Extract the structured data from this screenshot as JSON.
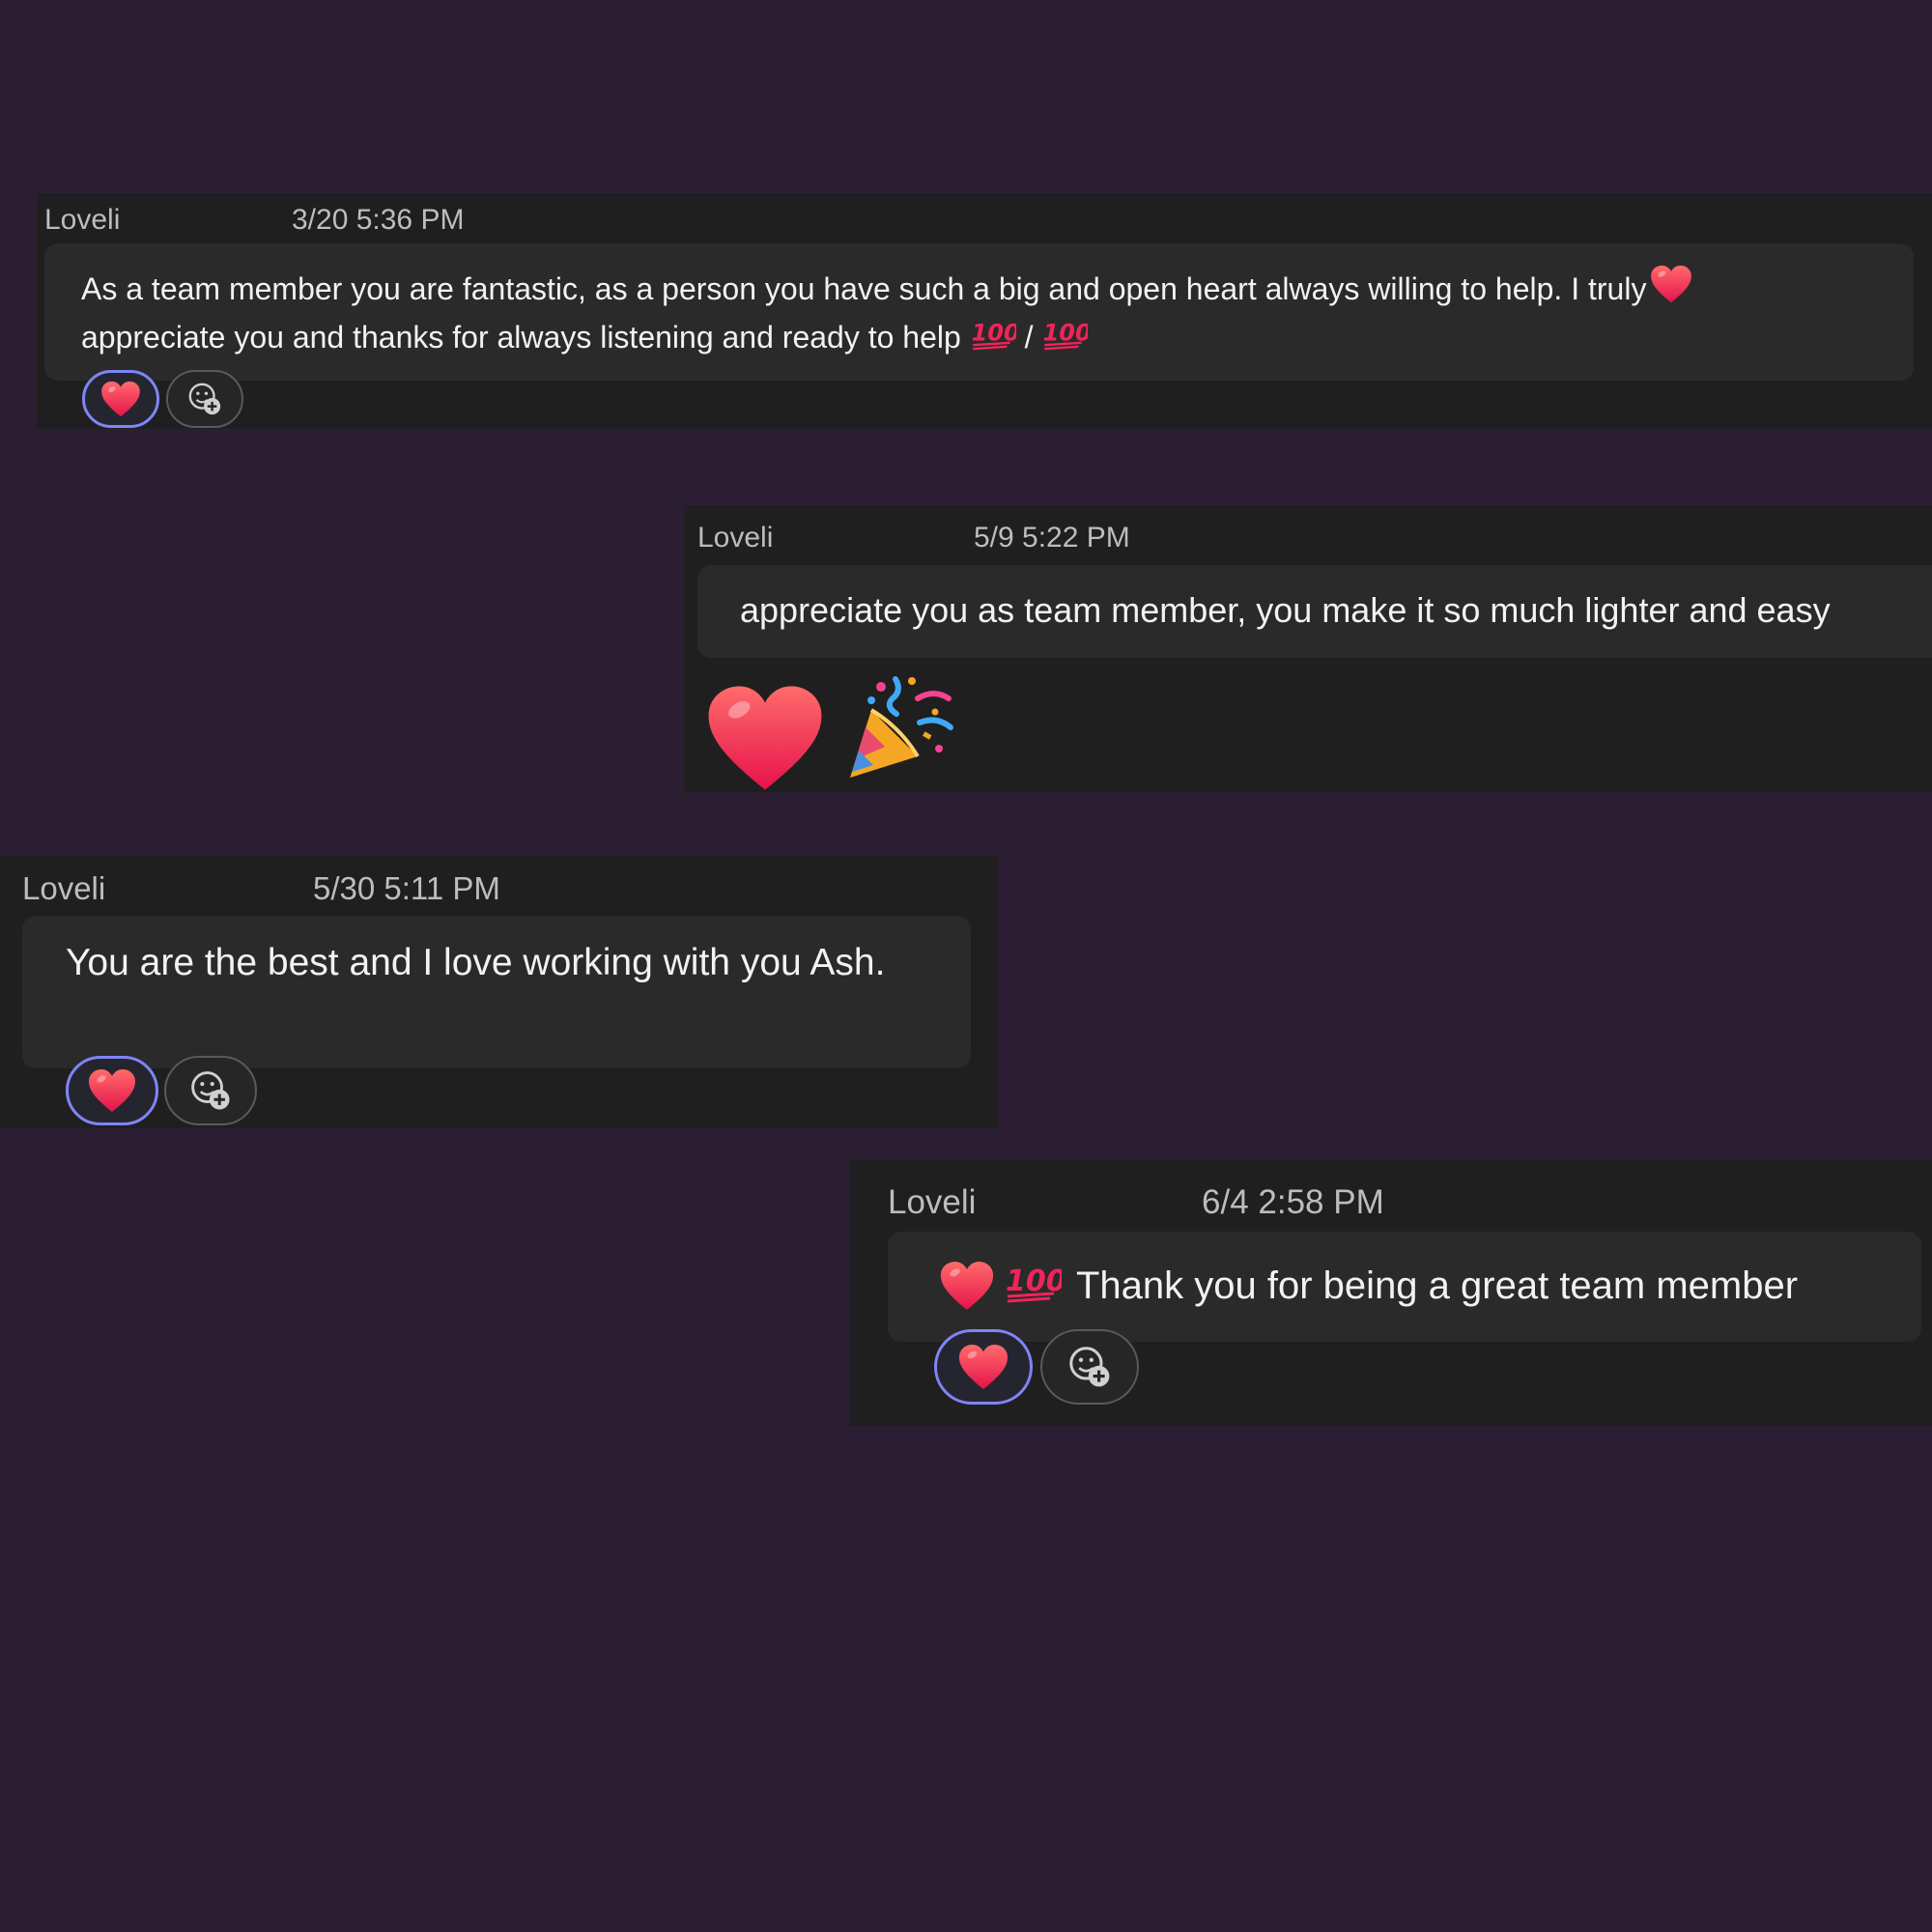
{
  "colors": {
    "background": "#2c1e32",
    "card": "#1f1f1f",
    "bubble": "#2a2a2a",
    "reaction_border": "#7f85f5",
    "heart": "#f6335a"
  },
  "messages": [
    {
      "sender": "Loveli",
      "timestamp": "3/20 5:36 PM",
      "line1": "As a team member you are fantastic, as a person you have such a big and  open  heart always willing to help. I truly",
      "line2": " appreciate you and thanks for always listening and ready to help",
      "hundred_a": "100",
      "slash": "/",
      "hundred_b": "100",
      "reaction_icon": "heart-icon",
      "add_reaction_icon": "add-reaction-icon"
    },
    {
      "sender": "Loveli",
      "timestamp": "5/9 5:22 PM",
      "text": "appreciate you as team member, you make  it so much lighter and easy",
      "stickers": [
        "heart-icon",
        "party-popper-icon"
      ]
    },
    {
      "sender": "Loveli",
      "timestamp": "5/30 5:11 PM",
      "text": "You are the best and I love working with you Ash.",
      "reaction_icon": "heart-icon",
      "add_reaction_icon": "add-reaction-icon"
    },
    {
      "sender": "Loveli",
      "timestamp": "6/4 2:58 PM",
      "hundred": "100",
      "text": "Thank you for being a great team member",
      "reaction_icon": "heart-icon",
      "add_reaction_icon": "add-reaction-icon"
    }
  ]
}
